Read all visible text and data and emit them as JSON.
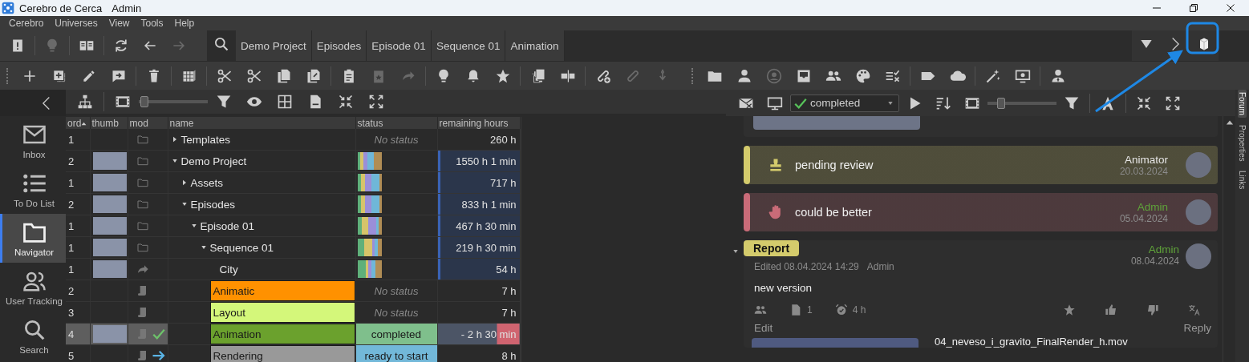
{
  "window": {
    "title": "Cerebro de Cerca",
    "user": "Admin"
  },
  "menu": [
    "Cerebro",
    "Universes",
    "View",
    "Tools",
    "Help"
  ],
  "breadcrumbs": [
    "Demo Project",
    "Episodes",
    "Episode 01",
    "Sequence 01",
    "Animation"
  ],
  "sidebar": {
    "items": [
      {
        "label": "Inbox",
        "selected": false,
        "kind": "inbox"
      },
      {
        "label": "To Do List",
        "selected": false,
        "kind": "todo"
      },
      {
        "label": "Navigator",
        "selected": true,
        "kind": "navigator"
      },
      {
        "label": "User Tracking",
        "selected": false,
        "kind": "users"
      },
      {
        "label": "Search",
        "selected": false,
        "kind": "search"
      }
    ]
  },
  "navigator_toolbar": {
    "thumb_size": {
      "level": 0.08
    }
  },
  "table": {
    "columns": [
      {
        "label": "ord",
        "sorted": true
      },
      {
        "label": "thumb",
        "sorted": false
      },
      {
        "label": "mod",
        "sorted": false
      },
      {
        "label": "name",
        "sorted": false
      },
      {
        "label": "status",
        "sorted": false
      },
      {
        "label": "remaining hours",
        "sorted": false
      }
    ],
    "rows": [
      {
        "ord": "1",
        "thumb": false,
        "kind": "folder",
        "name": "Templates",
        "expanded": false,
        "status": {
          "kind": "empty",
          "label": "No status"
        },
        "remaining": "260 h",
        "tracked": false,
        "selected": false
      },
      {
        "ord": "2",
        "thumb": true,
        "kind": "folder",
        "name": "Demo Project",
        "expanded": true,
        "status": {
          "kind": "bar"
        },
        "remaining": "1550 h 1 min",
        "tracked": true,
        "selected": false,
        "children": [
          {
            "ord": "1",
            "thumb": true,
            "kind": "folder",
            "name": "Assets",
            "expanded": false,
            "status": {
              "kind": "bar"
            },
            "remaining": "717 h",
            "tracked": true,
            "selected": false
          },
          {
            "ord": "2",
            "thumb": true,
            "kind": "folder",
            "name": "Episodes",
            "expanded": true,
            "status": {
              "kind": "bar"
            },
            "remaining": "833 h 1 min",
            "tracked": true,
            "selected": false,
            "children": [
              {
                "ord": "1",
                "thumb": true,
                "kind": "folder",
                "name": "Episode 01",
                "expanded": true,
                "status": {
                  "kind": "bar"
                },
                "remaining": "467 h 30 min",
                "tracked": true,
                "selected": false,
                "children": [
                  {
                    "ord": "1",
                    "thumb": true,
                    "kind": "folder",
                    "name": "Sequence 01",
                    "expanded": true,
                    "status": {
                      "kind": "bar"
                    },
                    "remaining": "219 h 30 min",
                    "tracked": true,
                    "selected": false,
                    "children": [
                      {
                        "ord": "1",
                        "thumb": true,
                        "kind": "shot",
                        "name": "City",
                        "status": {
                          "kind": "bar"
                        },
                        "remaining": "54 h",
                        "tracked": true,
                        "selected": false
                      },
                      {
                        "ord": "2",
                        "thumb": false,
                        "kind": "task",
                        "name": "Animatic",
                        "color": "#ff9100",
                        "done": false,
                        "ready": false,
                        "status": {
                          "kind": "empty",
                          "label": "No status"
                        },
                        "remaining": "7 h",
                        "tracked": false,
                        "selected": false
                      },
                      {
                        "ord": "3",
                        "thumb": false,
                        "kind": "task",
                        "name": "Layout",
                        "color": "#d4f77a",
                        "done": false,
                        "ready": false,
                        "status": {
                          "kind": "empty",
                          "label": "No status"
                        },
                        "remaining": "7 h",
                        "tracked": false,
                        "selected": false
                      },
                      {
                        "ord": "4",
                        "thumb": true,
                        "kind": "task",
                        "name": "Animation",
                        "color": "#6ba12d",
                        "done": true,
                        "ready": false,
                        "status": {
                          "kind": "label",
                          "label": "completed",
                          "color": "#7fbf8c"
                        },
                        "remaining": "- 2 h 30 min",
                        "overdue": true,
                        "tracked": false,
                        "selected": true
                      },
                      {
                        "ord": "5",
                        "thumb": false,
                        "kind": "task",
                        "name": "Rendering",
                        "color": "#999999",
                        "done": false,
                        "ready": true,
                        "status": {
                          "kind": "label",
                          "label": "ready to start",
                          "color": "#72b8d9"
                        },
                        "remaining": "8 h",
                        "tracked": false,
                        "selected": false
                      }
                    ]
                  }
                ]
              }
            ]
          }
        ]
      }
    ]
  },
  "forum_toolbar": {
    "status_filter": "completed",
    "zoom": {
      "level": 0.2
    }
  },
  "forum": {
    "events": [
      {
        "kind": "review",
        "label": "pending review",
        "color": "#d4cb6c",
        "author": {
          "name": "Animator",
          "color": "#e6e6e6"
        },
        "date": "20.03.2024"
      },
      {
        "kind": "rejected",
        "label": "could be better",
        "color": "#c96b78",
        "author": {
          "name": "Admin",
          "color": "#5fa33a"
        },
        "date": "05.04.2024"
      }
    ],
    "message": {
      "tag": "Report",
      "expanded": true,
      "edited": "Edited 08.04.2024 14:29",
      "editor": "Admin",
      "author": {
        "name": "Admin",
        "color": "#5fa33a"
      },
      "date": "08.04.2024",
      "body": "new version",
      "attachments": "1",
      "hours": "4 h",
      "actions": [
        "Edit",
        "Reply"
      ],
      "file": "04_neveso_i_gravito_FinalRender_h.mov"
    }
  },
  "side_tabs": [
    {
      "label": "Forum",
      "selected": true
    },
    {
      "label": "Properties",
      "selected": false
    },
    {
      "label": "Links",
      "selected": false
    }
  ]
}
